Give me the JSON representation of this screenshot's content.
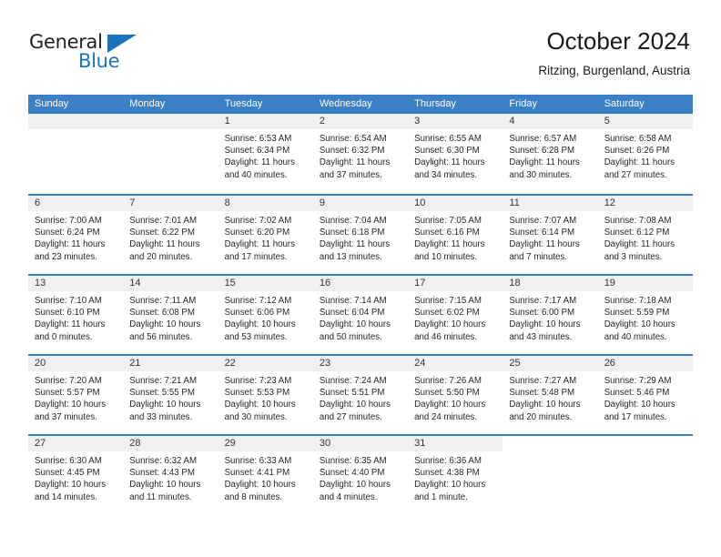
{
  "brand": {
    "name_part1": "General",
    "name_part2": "Blue",
    "accent_color": "#1b74bb"
  },
  "header": {
    "title": "October 2024",
    "subtitle": "Ritzing, Burgenland, Austria"
  },
  "calendar": {
    "header_bg": "#3b7fc4",
    "daynum_bg": "#f0f0f0",
    "weekdays": [
      "Sunday",
      "Monday",
      "Tuesday",
      "Wednesday",
      "Thursday",
      "Friday",
      "Saturday"
    ],
    "labels": {
      "sunrise": "Sunrise:",
      "sunset": "Sunset:",
      "daylight": "Daylight:"
    },
    "weeks": [
      [
        {
          "day": "",
          "empty": true
        },
        {
          "day": "",
          "empty": true
        },
        {
          "day": "1",
          "sunrise": "Sunrise: 6:53 AM",
          "sunset": "Sunset: 6:34 PM",
          "daylight_line1": "Daylight: 11 hours",
          "daylight_line2": "and 40 minutes."
        },
        {
          "day": "2",
          "sunrise": "Sunrise: 6:54 AM",
          "sunset": "Sunset: 6:32 PM",
          "daylight_line1": "Daylight: 11 hours",
          "daylight_line2": "and 37 minutes."
        },
        {
          "day": "3",
          "sunrise": "Sunrise: 6:55 AM",
          "sunset": "Sunset: 6:30 PM",
          "daylight_line1": "Daylight: 11 hours",
          "daylight_line2": "and 34 minutes."
        },
        {
          "day": "4",
          "sunrise": "Sunrise: 6:57 AM",
          "sunset": "Sunset: 6:28 PM",
          "daylight_line1": "Daylight: 11 hours",
          "daylight_line2": "and 30 minutes."
        },
        {
          "day": "5",
          "sunrise": "Sunrise: 6:58 AM",
          "sunset": "Sunset: 6:26 PM",
          "daylight_line1": "Daylight: 11 hours",
          "daylight_line2": "and 27 minutes."
        }
      ],
      [
        {
          "day": "6",
          "sunrise": "Sunrise: 7:00 AM",
          "sunset": "Sunset: 6:24 PM",
          "daylight_line1": "Daylight: 11 hours",
          "daylight_line2": "and 23 minutes."
        },
        {
          "day": "7",
          "sunrise": "Sunrise: 7:01 AM",
          "sunset": "Sunset: 6:22 PM",
          "daylight_line1": "Daylight: 11 hours",
          "daylight_line2": "and 20 minutes."
        },
        {
          "day": "8",
          "sunrise": "Sunrise: 7:02 AM",
          "sunset": "Sunset: 6:20 PM",
          "daylight_line1": "Daylight: 11 hours",
          "daylight_line2": "and 17 minutes."
        },
        {
          "day": "9",
          "sunrise": "Sunrise: 7:04 AM",
          "sunset": "Sunset: 6:18 PM",
          "daylight_line1": "Daylight: 11 hours",
          "daylight_line2": "and 13 minutes."
        },
        {
          "day": "10",
          "sunrise": "Sunrise: 7:05 AM",
          "sunset": "Sunset: 6:16 PM",
          "daylight_line1": "Daylight: 11 hours",
          "daylight_line2": "and 10 minutes."
        },
        {
          "day": "11",
          "sunrise": "Sunrise: 7:07 AM",
          "sunset": "Sunset: 6:14 PM",
          "daylight_line1": "Daylight: 11 hours",
          "daylight_line2": "and 7 minutes."
        },
        {
          "day": "12",
          "sunrise": "Sunrise: 7:08 AM",
          "sunset": "Sunset: 6:12 PM",
          "daylight_line1": "Daylight: 11 hours",
          "daylight_line2": "and 3 minutes."
        }
      ],
      [
        {
          "day": "13",
          "sunrise": "Sunrise: 7:10 AM",
          "sunset": "Sunset: 6:10 PM",
          "daylight_line1": "Daylight: 11 hours",
          "daylight_line2": "and 0 minutes."
        },
        {
          "day": "14",
          "sunrise": "Sunrise: 7:11 AM",
          "sunset": "Sunset: 6:08 PM",
          "daylight_line1": "Daylight: 10 hours",
          "daylight_line2": "and 56 minutes."
        },
        {
          "day": "15",
          "sunrise": "Sunrise: 7:12 AM",
          "sunset": "Sunset: 6:06 PM",
          "daylight_line1": "Daylight: 10 hours",
          "daylight_line2": "and 53 minutes."
        },
        {
          "day": "16",
          "sunrise": "Sunrise: 7:14 AM",
          "sunset": "Sunset: 6:04 PM",
          "daylight_line1": "Daylight: 10 hours",
          "daylight_line2": "and 50 minutes."
        },
        {
          "day": "17",
          "sunrise": "Sunrise: 7:15 AM",
          "sunset": "Sunset: 6:02 PM",
          "daylight_line1": "Daylight: 10 hours",
          "daylight_line2": "and 46 minutes."
        },
        {
          "day": "18",
          "sunrise": "Sunrise: 7:17 AM",
          "sunset": "Sunset: 6:00 PM",
          "daylight_line1": "Daylight: 10 hours",
          "daylight_line2": "and 43 minutes."
        },
        {
          "day": "19",
          "sunrise": "Sunrise: 7:18 AM",
          "sunset": "Sunset: 5:59 PM",
          "daylight_line1": "Daylight: 10 hours",
          "daylight_line2": "and 40 minutes."
        }
      ],
      [
        {
          "day": "20",
          "sunrise": "Sunrise: 7:20 AM",
          "sunset": "Sunset: 5:57 PM",
          "daylight_line1": "Daylight: 10 hours",
          "daylight_line2": "and 37 minutes."
        },
        {
          "day": "21",
          "sunrise": "Sunrise: 7:21 AM",
          "sunset": "Sunset: 5:55 PM",
          "daylight_line1": "Daylight: 10 hours",
          "daylight_line2": "and 33 minutes."
        },
        {
          "day": "22",
          "sunrise": "Sunrise: 7:23 AM",
          "sunset": "Sunset: 5:53 PM",
          "daylight_line1": "Daylight: 10 hours",
          "daylight_line2": "and 30 minutes."
        },
        {
          "day": "23",
          "sunrise": "Sunrise: 7:24 AM",
          "sunset": "Sunset: 5:51 PM",
          "daylight_line1": "Daylight: 10 hours",
          "daylight_line2": "and 27 minutes."
        },
        {
          "day": "24",
          "sunrise": "Sunrise: 7:26 AM",
          "sunset": "Sunset: 5:50 PM",
          "daylight_line1": "Daylight: 10 hours",
          "daylight_line2": "and 24 minutes."
        },
        {
          "day": "25",
          "sunrise": "Sunrise: 7:27 AM",
          "sunset": "Sunset: 5:48 PM",
          "daylight_line1": "Daylight: 10 hours",
          "daylight_line2": "and 20 minutes."
        },
        {
          "day": "26",
          "sunrise": "Sunrise: 7:29 AM",
          "sunset": "Sunset: 5:46 PM",
          "daylight_line1": "Daylight: 10 hours",
          "daylight_line2": "and 17 minutes."
        }
      ],
      [
        {
          "day": "27",
          "sunrise": "Sunrise: 6:30 AM",
          "sunset": "Sunset: 4:45 PM",
          "daylight_line1": "Daylight: 10 hours",
          "daylight_line2": "and 14 minutes."
        },
        {
          "day": "28",
          "sunrise": "Sunrise: 6:32 AM",
          "sunset": "Sunset: 4:43 PM",
          "daylight_line1": "Daylight: 10 hours",
          "daylight_line2": "and 11 minutes."
        },
        {
          "day": "29",
          "sunrise": "Sunrise: 6:33 AM",
          "sunset": "Sunset: 4:41 PM",
          "daylight_line1": "Daylight: 10 hours",
          "daylight_line2": "and 8 minutes."
        },
        {
          "day": "30",
          "sunrise": "Sunrise: 6:35 AM",
          "sunset": "Sunset: 4:40 PM",
          "daylight_line1": "Daylight: 10 hours",
          "daylight_line2": "and 4 minutes."
        },
        {
          "day": "31",
          "sunrise": "Sunrise: 6:36 AM",
          "sunset": "Sunset: 4:38 PM",
          "daylight_line1": "Daylight: 10 hours",
          "daylight_line2": "and 1 minute."
        },
        {
          "day": "",
          "empty": true,
          "blank": true
        },
        {
          "day": "",
          "empty": true,
          "blank": true
        }
      ]
    ]
  }
}
